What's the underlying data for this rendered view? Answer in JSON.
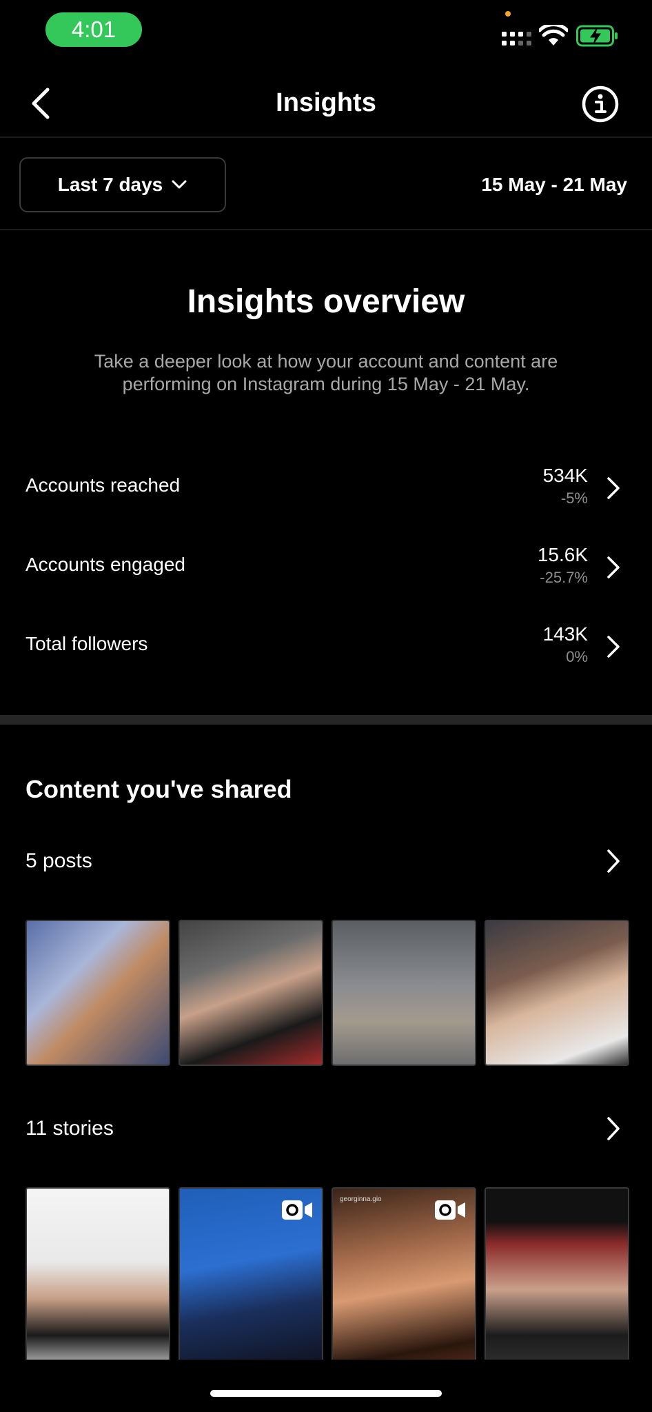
{
  "status_bar": {
    "time": "4:01"
  },
  "header": {
    "title": "Insights"
  },
  "filter": {
    "range_label": "Last 7 days",
    "date_range": "15 May - 21 May"
  },
  "overview": {
    "title": "Insights overview",
    "description": "Take a deeper look at how your account and content are performing on Instagram during 15 May - 21 May.",
    "metrics": [
      {
        "label": "Accounts reached",
        "value": "534K",
        "change": "-5%"
      },
      {
        "label": "Accounts engaged",
        "value": "15.6K",
        "change": "-25.7%"
      },
      {
        "label": "Total followers",
        "value": "143K",
        "change": "0%"
      }
    ]
  },
  "content": {
    "title": "Content you've shared",
    "posts_label": "5 posts",
    "stories_label": "11 stories",
    "story_username": "georginna.gio"
  },
  "icons": {
    "back": "chevron-left-icon",
    "info": "info-circle-icon",
    "dropdown": "chevron-down-icon",
    "row_chevron": "chevron-right-icon",
    "video": "video-camera-icon"
  },
  "colors": {
    "time_pill": "#34c759",
    "battery": "#34c759",
    "background": "#000000"
  }
}
